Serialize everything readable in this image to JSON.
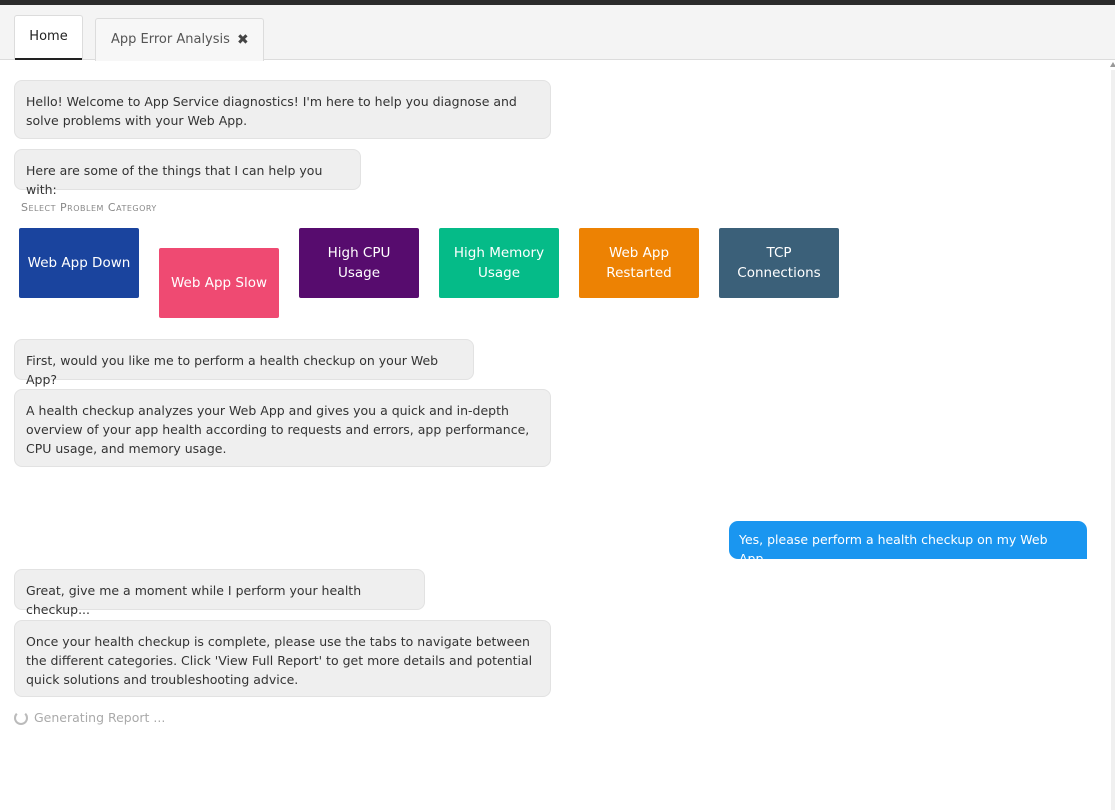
{
  "tabs": {
    "home": "Home",
    "analysis": "App Error Analysis",
    "close_glyph": "✖"
  },
  "messages": {
    "welcome": "Hello! Welcome to App Service diagnostics! I'm here to help you diagnose and solve problems with your Web App.",
    "help_intro": "Here are some of the things that I can help you with:",
    "health_question": "First, would you like me to perform a health checkup on your Web App?",
    "health_explain": "A health checkup analyzes your Web App and gives you a quick and in-depth overview of your app health according to requests and errors, app performance, CPU usage, and memory usage.",
    "user_reply": "Yes, please perform a health checkup on my Web App.",
    "wait": "Great, give me a moment while I perform your health checkup...",
    "tabs_hint": "Once your health checkup is complete, please use the tabs to navigate between the different categories. Click 'View Full Report' to get more details and potential quick solutions and troubleshooting advice."
  },
  "category": {
    "label": "Select Problem Category",
    "buttons": [
      {
        "label": "Web App Down",
        "color": "#1a449e"
      },
      {
        "label": "Web App Slow",
        "color": "#ef4a72"
      },
      {
        "label": "High CPU Usage",
        "color": "#570c6e"
      },
      {
        "label": "High Memory Usage",
        "color": "#05bb88"
      },
      {
        "label": "Web App Restarted",
        "color": "#ed8203"
      },
      {
        "label": "TCP Connections",
        "color": "#3b6079"
      }
    ]
  },
  "status": {
    "loading": "Generating Report ..."
  },
  "colors": {
    "user_bubble": "#1a96f0",
    "bot_bubble": "#efefef"
  }
}
